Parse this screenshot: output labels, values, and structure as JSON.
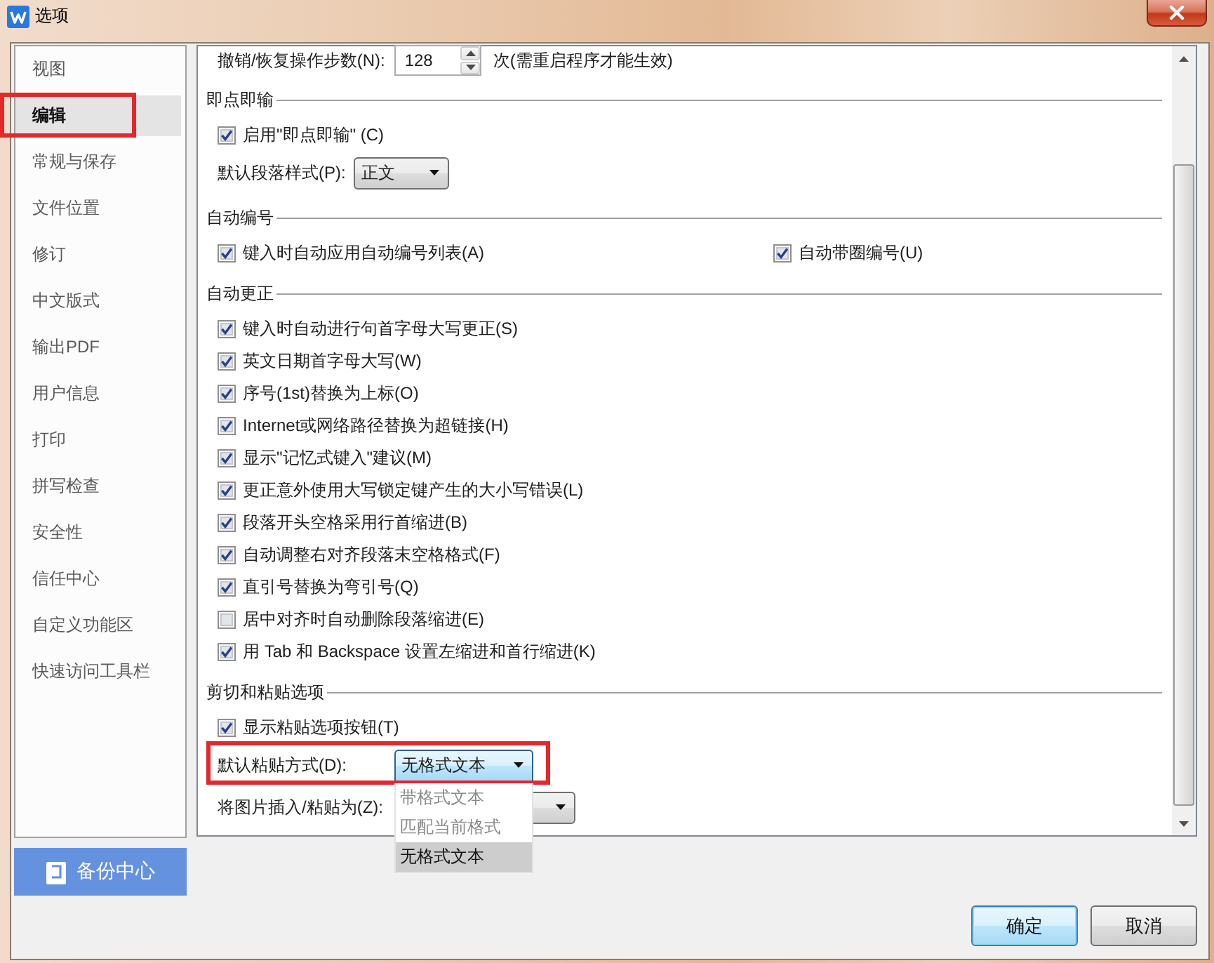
{
  "window": {
    "title": "选项"
  },
  "sidebar": {
    "items": [
      {
        "label": "视图",
        "selected": false,
        "annotated": false
      },
      {
        "label": "编辑",
        "selected": true,
        "annotated": true
      },
      {
        "label": "常规与保存",
        "selected": false,
        "annotated": false
      },
      {
        "label": "文件位置",
        "selected": false,
        "annotated": false
      },
      {
        "label": "修订",
        "selected": false,
        "annotated": false
      },
      {
        "label": "中文版式",
        "selected": false,
        "annotated": false
      },
      {
        "label": "输出PDF",
        "selected": false,
        "annotated": false
      },
      {
        "label": "用户信息",
        "selected": false,
        "annotated": false
      },
      {
        "label": "打印",
        "selected": false,
        "annotated": false
      },
      {
        "label": "拼写检查",
        "selected": false,
        "annotated": false
      },
      {
        "label": "安全性",
        "selected": false,
        "annotated": false
      },
      {
        "label": "信任中心",
        "selected": false,
        "annotated": false
      },
      {
        "label": "自定义功能区",
        "selected": false,
        "annotated": false
      },
      {
        "label": "快速访问工具栏",
        "selected": false,
        "annotated": false
      }
    ],
    "backup_button": {
      "label": "备份中心"
    }
  },
  "content": {
    "undo_steps": {
      "label": "撤销/恢复操作步数(N):",
      "value": "128",
      "hint": "次(需重启程序才能生效)"
    },
    "sections": [
      {
        "title": "即点即输",
        "rows": [
          {
            "kind": "checkbox",
            "label": "启用\"即点即输\" (C)",
            "checked": true
          },
          {
            "kind": "select",
            "label": "默认段落样式(P):",
            "value": "正文",
            "focused": false,
            "annotated": false,
            "open": false
          }
        ]
      },
      {
        "title": "自动编号",
        "rows": [
          {
            "kind": "checkbox_pair",
            "items": [
              {
                "label": "键入时自动应用自动编号列表(A)",
                "checked": true
              },
              {
                "label": "自动带圈编号(U)",
                "checked": true
              }
            ]
          }
        ]
      },
      {
        "title": "自动更正",
        "rows": [
          {
            "kind": "checkbox",
            "label": "键入时自动进行句首字母大写更正(S)",
            "checked": true
          },
          {
            "kind": "checkbox",
            "label": "英文日期首字母大写(W)",
            "checked": true
          },
          {
            "kind": "checkbox",
            "label": "序号(1st)替换为上标(O)",
            "checked": true
          },
          {
            "kind": "checkbox",
            "label": "Internet或网络路径替换为超链接(H)",
            "checked": true
          },
          {
            "kind": "checkbox",
            "label": "显示\"记忆式键入\"建议(M)",
            "checked": true
          },
          {
            "kind": "checkbox",
            "label": "更正意外使用大写锁定键产生的大小写错误(L)",
            "checked": true
          },
          {
            "kind": "checkbox",
            "label": "段落开头空格采用行首缩进(B)",
            "checked": true
          },
          {
            "kind": "checkbox",
            "label": "自动调整右对齐段落末空格格式(F)",
            "checked": true
          },
          {
            "kind": "checkbox",
            "label": "直引号替换为弯引号(Q)",
            "checked": true
          },
          {
            "kind": "checkbox",
            "label": "居中对齐时自动删除段落缩进(E)",
            "checked": false
          },
          {
            "kind": "checkbox",
            "label": "用 Tab 和 Backspace 设置左缩进和首行缩进(K)",
            "checked": true
          }
        ]
      },
      {
        "title": "剪切和粘贴选项",
        "rows": [
          {
            "kind": "checkbox",
            "label": "显示粘贴选项按钮(T)",
            "checked": true
          },
          {
            "kind": "select",
            "label": "默认粘贴方式(D):",
            "value": "无格式文本",
            "focused": true,
            "annotated": true,
            "open": true,
            "options": [
              {
                "label": "带格式文本",
                "selected": false
              },
              {
                "label": "匹配当前格式",
                "selected": false
              },
              {
                "label": "无格式文本",
                "selected": true
              }
            ]
          },
          {
            "kind": "select",
            "label": "将图片插入/粘贴为(Z):",
            "focused": false,
            "annotated": false,
            "open": false
          }
        ]
      }
    ]
  },
  "buttons": [
    {
      "label": "确定",
      "default": true
    },
    {
      "label": "取消",
      "default": false
    }
  ]
}
